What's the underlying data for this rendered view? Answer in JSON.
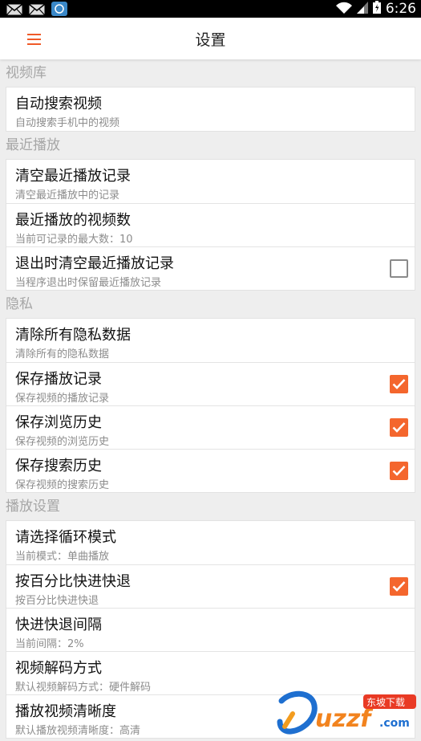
{
  "status_bar": {
    "time": "6:26",
    "icons": [
      "mail-icon",
      "mail-icon",
      "app-notification-icon",
      "wifi-icon",
      "signal-icon",
      "battery-icon"
    ]
  },
  "app_bar": {
    "title": "设置",
    "menu_icon": "hamburger-menu-icon",
    "accent_color": "#f05a28"
  },
  "sections": {
    "library": {
      "header": "视频库",
      "items": [
        {
          "title": "自动搜索视频",
          "subtitle": "自动搜索手机中的视频"
        }
      ]
    },
    "recent": {
      "header": "最近播放",
      "items": [
        {
          "title": "清空最近播放记录",
          "subtitle": "清空最近播放中的记录"
        },
        {
          "title": "最近播放的视频数",
          "subtitle": "当前可记录的最大数：10"
        },
        {
          "title": "退出时清空最近播放记录",
          "subtitle": "当程序退出时保留最近播放记录",
          "checked": false
        }
      ]
    },
    "privacy": {
      "header": "隐私",
      "items": [
        {
          "title": "清除所有隐私数据",
          "subtitle": "清除所有的隐私数据"
        },
        {
          "title": "保存播放记录",
          "subtitle": "保存视频的播放记录",
          "checked": true
        },
        {
          "title": "保存浏览历史",
          "subtitle": "保存视频的浏览历史",
          "checked": true
        },
        {
          "title": "保存搜索历史",
          "subtitle": "保存视频的搜索历史",
          "checked": true
        }
      ]
    },
    "playback": {
      "header": "播放设置",
      "items": [
        {
          "title": "请选择循环模式",
          "subtitle": "当前模式：单曲播放"
        },
        {
          "title": "按百分比快进快退",
          "subtitle": "按百分比快进快退",
          "checked": true
        },
        {
          "title": "快进快退间隔",
          "subtitle": "当前间隔：2%"
        },
        {
          "title": "视频解码方式",
          "subtitle": "默认视频解码方式：硬件解码"
        },
        {
          "title": "播放视频清晰度",
          "subtitle": "默认播放视频清晰度：高清"
        }
      ]
    }
  },
  "colors": {
    "checkbox_checked": "#f4662d",
    "section_header_text": "#a6a6a6",
    "background": "#eeeeee"
  },
  "watermark": {
    "brand": "uzzf",
    "suffix": ".com",
    "tag": "东坡下载"
  }
}
